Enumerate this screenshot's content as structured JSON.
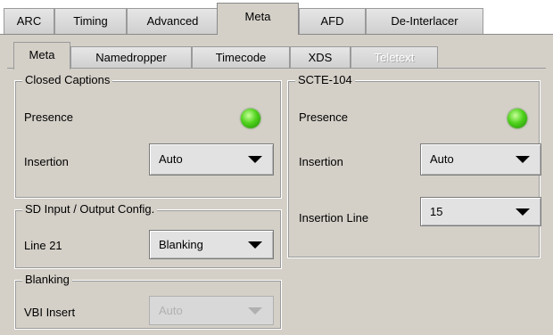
{
  "tabs_top": [
    {
      "label": "ARC",
      "active": false
    },
    {
      "label": "Timing",
      "active": false
    },
    {
      "label": "Advanced",
      "active": false
    },
    {
      "label": "Meta",
      "active": true
    },
    {
      "label": "AFD",
      "active": false
    },
    {
      "label": "De-Interlacer",
      "active": false
    }
  ],
  "tabs_sub": [
    {
      "label": "Meta",
      "active": true
    },
    {
      "label": "Namedropper",
      "active": false
    },
    {
      "label": "Timecode",
      "active": false
    },
    {
      "label": "XDS",
      "active": false
    },
    {
      "label": "Teletext",
      "active": false,
      "disabled": true
    }
  ],
  "closed_captions": {
    "title": "Closed Captions",
    "presence_label": "Presence",
    "insertion_label": "Insertion",
    "insertion_value": "Auto",
    "led_color": "#3cc81a"
  },
  "sd_io": {
    "title": "SD Input / Output Config.",
    "line21_label": "Line 21",
    "line21_value": "Blanking"
  },
  "blanking": {
    "title": "Blanking",
    "vbi_label": "VBI Insert",
    "vbi_value": "Auto",
    "vbi_disabled": true
  },
  "scte104": {
    "title": "SCTE-104",
    "presence_label": "Presence",
    "insertion_label": "Insertion",
    "insertion_value": "Auto",
    "insertion_line_label": "Insertion Line",
    "insertion_line_value": "15",
    "led_color": "#3cc81a"
  }
}
